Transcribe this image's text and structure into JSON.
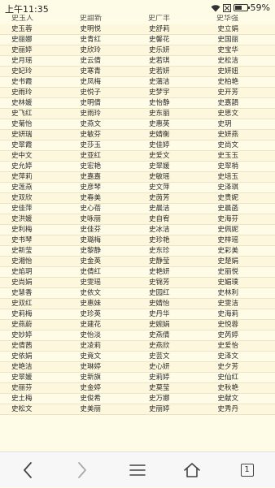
{
  "status_bar": {
    "time": "上午11:35",
    "battery": "59%",
    "battery_level": 0.59
  },
  "page_header": [
    "史玉人",
    "史甜新",
    "史广丰",
    "史华强"
  ],
  "names": [
    [
      "史玉蓉",
      "史明悦",
      "史舒莉",
      "史立娟"
    ],
    [
      "史丽娜",
      "史青红",
      "史馨花",
      "史国丽"
    ],
    [
      "史丽婷",
      "史欣玲",
      "史乐妍",
      "史宝华"
    ],
    [
      "史月瑶",
      "史云倩",
      "史若琪",
      "史松洁"
    ],
    [
      "史妃玲",
      "史寒青",
      "史若妍",
      "史妍妞"
    ],
    [
      "史书霞",
      "史凤梅",
      "史蒲洁",
      "史柏艳"
    ],
    [
      "史雨玲",
      "史悦子",
      "史梦宇",
      "史开芳"
    ],
    [
      "史林媛",
      "史明倩",
      "史怡静",
      "史嘉韻"
    ],
    [
      "史飞红",
      "史雨玲",
      "史东丽",
      "史思文"
    ],
    [
      "史菊怡",
      "史燕文",
      "史惠英",
      "史玥"
    ],
    [
      "史妍瑞",
      "史敏芬",
      "史婧衡",
      "史妍燕"
    ],
    [
      "史翠霞",
      "史莎玉",
      "史佳婷",
      "史尚文"
    ],
    [
      "史中文",
      "史亚红",
      "史爱文",
      "史玉玉"
    ],
    [
      "史允婷",
      "史宏艳",
      "史翠媛",
      "史翠梢"
    ],
    [
      "史萍莉",
      "史嘉嘉",
      "史敏瑶",
      "史培玉"
    ],
    [
      "史莲燕",
      "史彦琴",
      "史文萍",
      "史泽琪"
    ],
    [
      "史双欣",
      "史春美",
      "史茵芳",
      "史贵妮"
    ],
    [
      "史佳萍",
      "史心蓓",
      "史晨洁",
      "史晨菡"
    ],
    [
      "史洪媛",
      "史咏丽",
      "史自宥",
      "史海芬"
    ],
    [
      "史利梅",
      "史佳芬",
      "史冰洁",
      "史佩妮"
    ],
    [
      "史书琴",
      "史璐梅",
      "史珍艳",
      "史梓瑶"
    ],
    [
      "史新莹",
      "史黎静",
      "史东珍",
      "史彩美"
    ],
    [
      "史湘怡",
      "史金英",
      "史静莹",
      "史楚娟"
    ],
    [
      "史焰玥",
      "史倩红",
      "史艳妍",
      "史丽悦"
    ],
    [
      "史尚娟",
      "史雯瑶",
      "史锦芳",
      "史媚璞"
    ],
    [
      "史慧香",
      "史依文",
      "史园红",
      "史林利"
    ],
    [
      "史双红",
      "史惠妹",
      "史婧怡",
      "史雯洁"
    ],
    [
      "史莉梅",
      "史珍英",
      "史丹华",
      "史海莉"
    ],
    [
      "史燕蔚",
      "史建花",
      "史婉娟",
      "史悦蓉"
    ],
    [
      "史妙婷",
      "史怡淡",
      "史燕倩",
      "史芮婷"
    ],
    [
      "史倩茜",
      "史凌莉",
      "史燕欣",
      "史爱怡"
    ],
    [
      "史依娟",
      "史竟文",
      "史芸文",
      "史泽文"
    ],
    [
      "史艳洁",
      "史琳婷",
      "史心妍",
      "史夕芳"
    ],
    [
      "史翠媛",
      "史新旗",
      "史莉婷",
      "史仙红"
    ],
    [
      "史丽芬",
      "史金婷",
      "史莫莹",
      "史秋艳"
    ],
    [
      "史土梅",
      "史俊希",
      "史万娜",
      "史献文"
    ],
    [
      "史松文",
      "史美丽",
      "史丽婷",
      "史秀丹"
    ]
  ],
  "toolbar": {
    "back_icon": "chevron-left-icon",
    "forward_icon": "chevron-right-icon",
    "menu_icon": "hamburger-menu-icon",
    "home_icon": "home-icon",
    "tabs_count": "1"
  }
}
